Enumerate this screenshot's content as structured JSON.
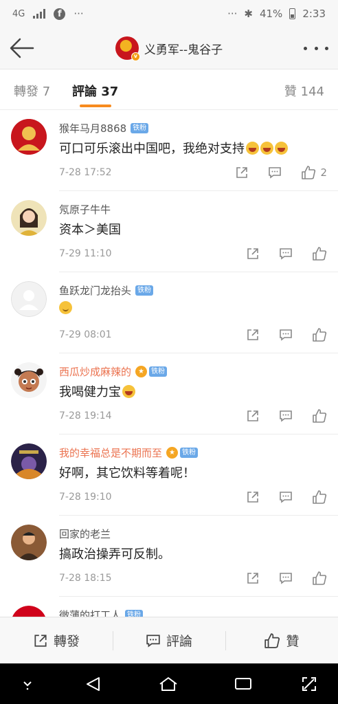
{
  "status": {
    "network": "4G",
    "battery": "41%",
    "time": "2:33"
  },
  "header": {
    "title": "义勇军--鬼谷子"
  },
  "tabs": {
    "repost": "轉發 7",
    "comments": "評論 37",
    "likes": "贊 144"
  },
  "comments": [
    {
      "name": "猴年马月8868",
      "badge": "铁粉",
      "text": "可口可乐滚出中国吧，我绝对支持",
      "emoji": "laugh-emoji x3",
      "time": "7-28 17:52",
      "likes": "2",
      "avatar_color": "#c8161d"
    },
    {
      "name": "氖原子牛牛",
      "badge": "",
      "text": "资本＞美国",
      "time": "7-29 11:10",
      "likes": "",
      "avatar_color": "#e9d8a6"
    },
    {
      "name": "鱼跃龙门龙抬头",
      "badge": "铁粉",
      "text": "",
      "emoji": "smile-emoji",
      "time": "7-29 08:01",
      "likes": "",
      "avatar_color": "#eeeeee"
    },
    {
      "name": "西瓜炒成麻辣的",
      "badge": "铁粉",
      "text": "我喝健力宝",
      "emoji": "laugh-emoji",
      "time": "7-28 19:14",
      "likes": "",
      "avatar_color": "#b9653a"
    },
    {
      "name": "我的幸福总是不期而至",
      "badge": "铁粉",
      "text": "好啊，其它饮料等着呢！",
      "time": "7-28 19:10",
      "likes": "",
      "avatar_color": "#3a2d5c"
    },
    {
      "name": "回家的老兰",
      "badge": "",
      "text": "搞政治操弄可反制。",
      "time": "7-28 18:15",
      "likes": "",
      "avatar_color": "#7a4a2a"
    },
    {
      "name": "微薄的打工人",
      "badge": "铁粉",
      "text": "",
      "time": "",
      "likes": "",
      "avatar_color": "#d0021b"
    }
  ],
  "bottom": {
    "repost": "轉發",
    "comment": "評論",
    "like": "贊"
  },
  "colors": {
    "accent": "#f78b1e",
    "fan_badge": "#6aa8e8",
    "vip_name": "#eb7350"
  }
}
